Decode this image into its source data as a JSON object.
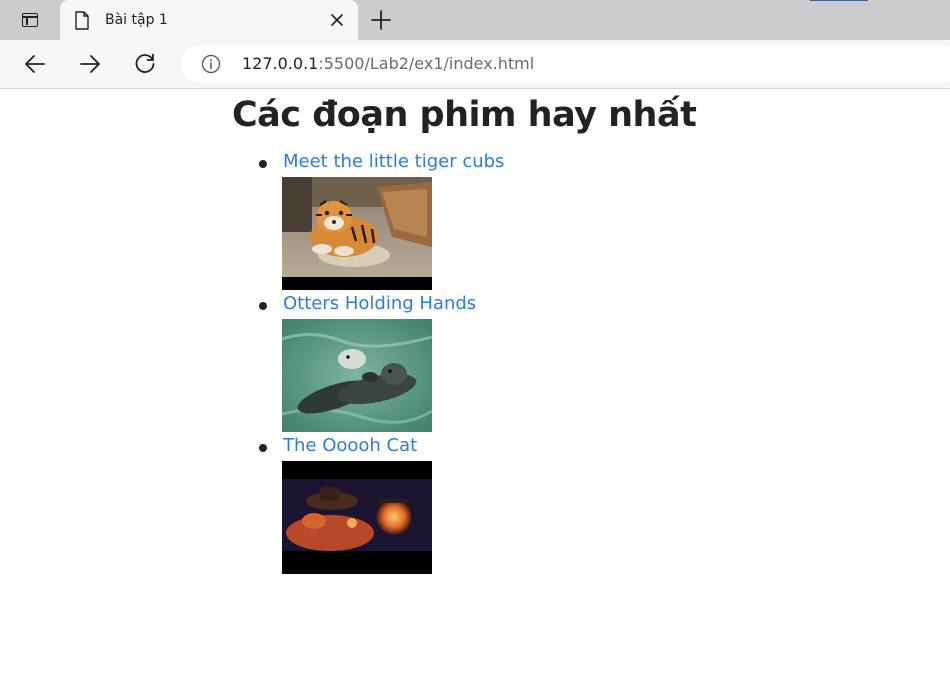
{
  "browser": {
    "tab": {
      "title": "Bài tập 1"
    },
    "address": {
      "host": "127.0.0.1",
      "rest": ":5500/Lab2/ex1/index.html"
    }
  },
  "page": {
    "title": "Các đoạn phim hay nhất",
    "videos": [
      {
        "label": "Meet the little tiger cubs"
      },
      {
        "label": "Otters Holding Hands"
      },
      {
        "label": "The Ooooh Cat"
      }
    ]
  },
  "colors": {
    "link": "#2b7de0",
    "heading": "#222222"
  }
}
